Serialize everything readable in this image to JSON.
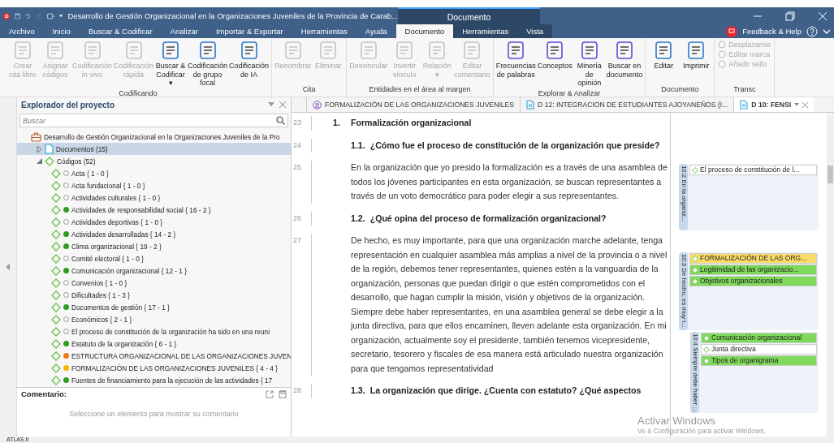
{
  "window": {
    "title": "Desarrollo de Gestión Organizacional en la Organizaciones Juveniles de la Provincia de Carab...",
    "context_title": "Documento",
    "feedback": "Feedback & Help"
  },
  "menu_tabs": [
    {
      "label": "Archivo",
      "selected": false,
      "kind": "main"
    },
    {
      "label": "Inicio",
      "selected": false,
      "kind": "main"
    },
    {
      "label": "Buscar & Codificar",
      "selected": false,
      "kind": "main"
    },
    {
      "label": "Analizar",
      "selected": false,
      "kind": "main"
    },
    {
      "label": "Importar & Exportar",
      "selected": false,
      "kind": "main"
    },
    {
      "label": "Herramientas",
      "selected": false,
      "kind": "main"
    },
    {
      "label": "Ayuda",
      "selected": false,
      "kind": "main"
    },
    {
      "label": "Documento",
      "selected": true,
      "kind": "context"
    },
    {
      "label": "Herramientas",
      "selected": false,
      "kind": "context"
    },
    {
      "label": "Vista",
      "selected": false,
      "kind": "context"
    }
  ],
  "ribbon": [
    {
      "group": "Codificando",
      "buttons": [
        {
          "label": "Crear cita libre",
          "disabled": true
        },
        {
          "label": "Asignar códigos",
          "disabled": true
        },
        {
          "label": "Codificación in vivo",
          "disabled": true
        },
        {
          "label": "Codificación rápida",
          "disabled": true
        },
        {
          "label": "Buscar & Codificar ▾",
          "disabled": false
        },
        {
          "label": "Codificación de grupo focal",
          "disabled": false
        },
        {
          "label": "Codificación de IA",
          "disabled": false
        }
      ]
    },
    {
      "group": "Cita",
      "buttons": [
        {
          "label": "Renombrar",
          "disabled": true
        },
        {
          "label": "Eliminar",
          "disabled": true
        }
      ]
    },
    {
      "group": "Entidades en el área al margen",
      "buttons": [
        {
          "label": "Desvincular",
          "disabled": true
        },
        {
          "label": "Invertir vínculo",
          "disabled": true
        },
        {
          "label": "Relación ▾",
          "disabled": true
        },
        {
          "label": "Editar comentario",
          "disabled": true
        }
      ]
    },
    {
      "group": "Explorar & Analizar",
      "buttons": [
        {
          "label": "Frecuencias de palabras",
          "disabled": false
        },
        {
          "label": "Conceptos",
          "disabled": false
        },
        {
          "label": "Minería de opinión",
          "disabled": false
        },
        {
          "label": "Buscar en documento",
          "disabled": false
        }
      ]
    },
    {
      "group": "Documento",
      "buttons": [
        {
          "label": "Editar",
          "disabled": false
        },
        {
          "label": "Imprimir",
          "disabled": false
        }
      ]
    },
    {
      "group": "Transc",
      "small_buttons": [
        {
          "label": "Desplazamie",
          "disabled": true
        },
        {
          "label": "Editar marca",
          "disabled": true
        },
        {
          "label": "Añadir sello",
          "disabled": true
        }
      ]
    }
  ],
  "project_explorer": {
    "title": "Explorador del proyecto",
    "search": {
      "placeholder": "Buscar"
    },
    "tree": {
      "label": "Desarrollo de Gestión Organizacional en la Organizaciones Juveniles de la Pro",
      "children": [
        {
          "label": "Documentos (15)",
          "kind": "documents",
          "selected": true,
          "expanded": false
        },
        {
          "label": "Códigos (52)",
          "kind": "codes",
          "selected": false,
          "expanded": true,
          "children": [
            {
              "label": "Acta { 1 - 0 }",
              "selected": false
            },
            {
              "label": "Acta fundacional { 1 - 0 }",
              "selected": false
            },
            {
              "label": "Actividades culturales { 1 - 0 }",
              "selected": false
            },
            {
              "label": "Actividades de responsabilidad social { 16 - 2 }",
              "selected": false,
              "color": "#2e9e1f"
            },
            {
              "label": "Actividades deportivas { 1 - 0 }",
              "selected": false
            },
            {
              "label": "Actividades desarrolladas { 14 - 2 }",
              "selected": false,
              "color": "#2e9e1f"
            },
            {
              "label": "Clima organizacional { 19 - 2 }",
              "selected": false,
              "color": "#2e9e1f"
            },
            {
              "label": "Comité electoral { 1 - 0 }",
              "selected": false
            },
            {
              "label": "Comunicación organizacional { 12 - 1 }",
              "selected": false,
              "color": "#2e9e1f"
            },
            {
              "label": "Convenios { 1 - 0 }",
              "selected": false
            },
            {
              "label": "Dificultades { 1 - 3 }",
              "selected": false
            },
            {
              "label": "Documentos de gestión { 17 - 1 }",
              "selected": false,
              "color": "#2e9e1f"
            },
            {
              "label": "Económicos { 2 - 1 }",
              "selected": false
            },
            {
              "label": "El proceso de constitución de la organización ha sido en una reuni",
              "selected": false
            },
            {
              "label": "Estatuto de la organización { 6 - 1 }",
              "selected": false,
              "color": "#2e9e1f"
            },
            {
              "label": "ESTRUCTURA ORGANIZACIONAL DE LAS ORGANIZACIONES JUVEN",
              "selected": false,
              "color": "#f07a1a"
            },
            {
              "label": "FORMALIZACIÓN DE LAS ORGANIZACIONES JUVENILES { 4 - 4 }",
              "selected": false,
              "color": "#f5b800"
            },
            {
              "label": "Fuentes de financiamiento para la ejecución de las actividades { 17",
              "selected": false,
              "color": "#2e9e1f"
            }
          ]
        }
      ]
    }
  },
  "comment": {
    "title": "Comentario:",
    "placeholder": "Seleccione un elemento para mostrar su comentario"
  },
  "doc_tabs": [
    {
      "label": "FORMALIZACIÓN DE LAS ORGANIZACIONES JUVENILES",
      "kind": "code",
      "selected": false
    },
    {
      "label": "D 12: INTEGRACION DE ESTUDIANTES AJOYANEÑOS (I...",
      "kind": "document",
      "selected": false
    },
    {
      "label": "D 10: FENSI",
      "kind": "document",
      "selected": true
    }
  ],
  "document_lines": [
    {
      "number": "23",
      "kind": "heading1",
      "marker": "1.",
      "text": "Formalización organizacional"
    },
    {
      "number": "24",
      "kind": "heading2",
      "marker": "1.1.",
      "text": "¿Cómo fue el proceso de constitución de la organización que preside?"
    },
    {
      "number": "25",
      "kind": "paragraph",
      "text": "En la organización que yo presido la formalización es a través de una asamblea de todos los jóvenes participantes en esta organización, se buscan representantes a través de un voto democrático para poder elegir a sus representantes."
    },
    {
      "number": "26",
      "kind": "heading2",
      "marker": "1.2.",
      "text": "¿Qué opina del proceso de formalización organizacional?"
    },
    {
      "number": "27",
      "kind": "paragraph",
      "text": "De hecho, es muy importante, para que una organización marche adelante, tenga representación en cualquier asamblea más amplias a nivel de la provincia o a nivel de la región, debemos tener representantes, quienes estén a la vanguardia de la organización, personas que puedan dirigir o que estén comprometidos con el desarrollo, que hagan cumplir la misión, visión y objetivos de la organización. Siempre debe haber representantes, en una asamblea general se debe elegir a la junta directiva, para que ellos encaminen, lleven adelante esta organización. En mi organización, actualmente soy el presidente, también tenemos vicepresidente, secretario, tesorero y fiscales de esa manera está articulado nuestra organización para que tengamos representatividad"
    },
    {
      "number": "28",
      "kind": "heading2",
      "marker": "1.3.",
      "text": "La organización que dirige. ¿Cuenta con estatuto? ¿Qué aspectos"
    }
  ],
  "margin_quotes": [
    {
      "label": "10:2 En la organiz...",
      "codes": [
        {
          "name": "El proceso de constitución de l...",
          "color": "#ffffff"
        }
      ]
    },
    {
      "label": "10:3 De hecho, es muy i...",
      "codes": [
        {
          "name": "FORMALIZACIÓN DE LAS ORG...",
          "color": "#fbdc6a"
        },
        {
          "name": "Legitimidad de las organizacio...",
          "color": "#7fd95a"
        },
        {
          "name": "Objetivos organizacionales",
          "color": "#7fd95a"
        }
      ]
    },
    {
      "label": "10:4 Siempre debe haber ...",
      "codes": [
        {
          "name": "Comunicación organizacional",
          "color": "#7fd95a"
        },
        {
          "name": "Junta directiva",
          "color": "#ffffff"
        },
        {
          "name": "Tipos de organigrama",
          "color": "#7fd95a"
        }
      ]
    }
  ],
  "os_notice": {
    "title": "Activar Windows",
    "text": "Ve a Configuración para activar Windows."
  },
  "status_bar": {
    "text": "ATLAS.ti"
  }
}
